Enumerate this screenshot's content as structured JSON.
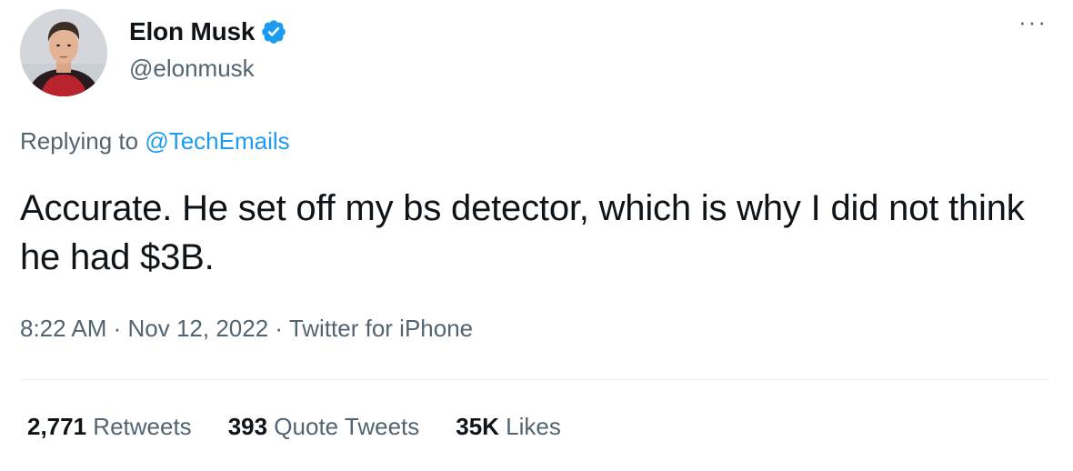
{
  "author": {
    "display_name": "Elon Musk",
    "handle": "@elonmusk",
    "verified": true,
    "verified_color": "#1d9bf0"
  },
  "more_menu": {
    "label": "···"
  },
  "reply": {
    "prefix": "Replying to ",
    "target": "@TechEmails"
  },
  "tweet": {
    "text": "Accurate. He set off my bs detector, which is why I did not think he had $3B."
  },
  "meta": {
    "time": "8:22 AM",
    "separator": " · ",
    "date": "Nov 12, 2022",
    "source": "Twitter for iPhone"
  },
  "stats": {
    "retweets_count": "2,771",
    "retweets_label": " Retweets",
    "quotes_count": "393",
    "quotes_label": " Quote Tweets",
    "likes_count": "35K",
    "likes_label": " Likes"
  },
  "colors": {
    "primary_text": "#0f1419",
    "secondary_text": "#536471",
    "link": "#1d9bf0",
    "divider": "#e6ecf0"
  }
}
